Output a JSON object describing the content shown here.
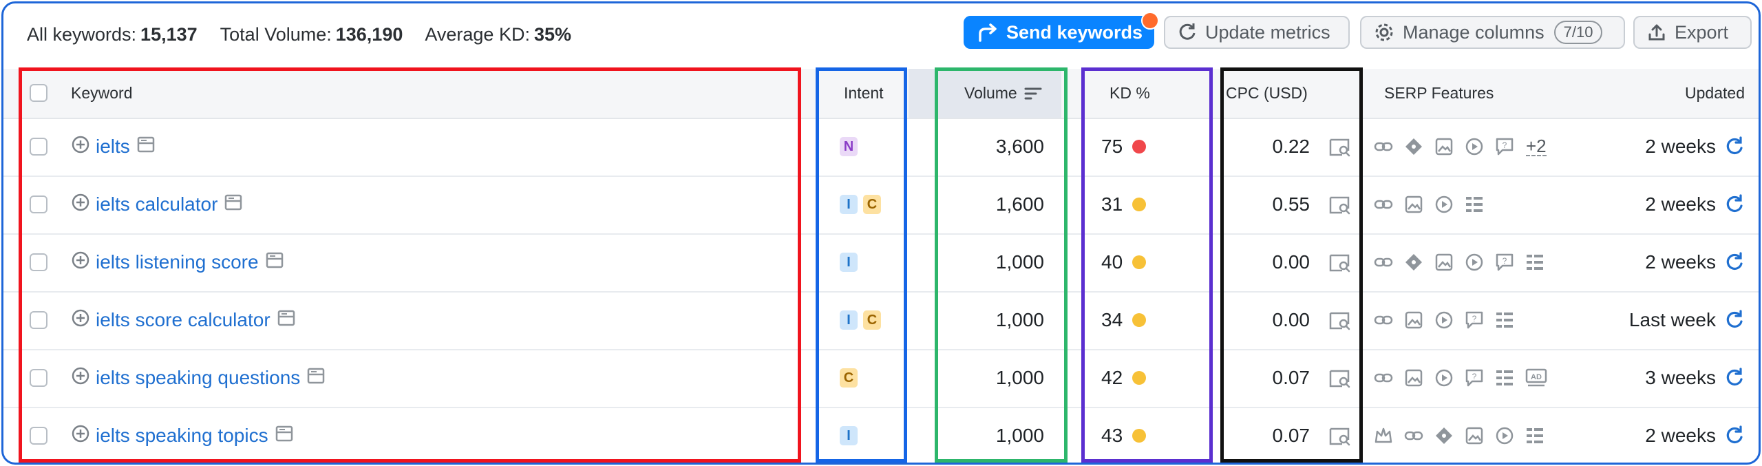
{
  "summary": {
    "all_keywords_label": "All keywords:",
    "all_keywords_value": "15,137",
    "total_volume_label": "Total Volume:",
    "total_volume_value": "136,190",
    "avg_kd_label": "Average KD:",
    "avg_kd_value": "35%"
  },
  "toolbar": {
    "send_label": "Send keywords",
    "update_label": "Update metrics",
    "manage_label": "Manage columns",
    "manage_count": "7/10",
    "export_label": "Export"
  },
  "columns": {
    "keyword": "Keyword",
    "intent": "Intent",
    "volume": "Volume",
    "kd": "KD %",
    "cpc": "CPC (USD)",
    "serp": "SERP Features",
    "updated": "Updated"
  },
  "rows": [
    {
      "keyword": "ielts",
      "intent": [
        "N"
      ],
      "volume": "3,600",
      "kd": "75",
      "kd_color": "#f0474b",
      "cpc": "0.22",
      "serp": [
        "link",
        "diamond",
        "image",
        "video",
        "qa"
      ],
      "more": "+2",
      "updated": "2 weeks"
    },
    {
      "keyword": "ielts calculator",
      "intent": [
        "I",
        "C"
      ],
      "volume": "1,600",
      "kd": "31",
      "kd_color": "#f7c137",
      "cpc": "0.55",
      "serp": [
        "link",
        "image",
        "video",
        "list"
      ],
      "more": "",
      "updated": "2 weeks"
    },
    {
      "keyword": "ielts listening score",
      "intent": [
        "I"
      ],
      "volume": "1,000",
      "kd": "40",
      "kd_color": "#f7c137",
      "cpc": "0.00",
      "serp": [
        "link",
        "diamond",
        "image",
        "video",
        "qa",
        "list"
      ],
      "more": "",
      "updated": "2 weeks"
    },
    {
      "keyword": "ielts score calculator",
      "intent": [
        "I",
        "C"
      ],
      "volume": "1,000",
      "kd": "34",
      "kd_color": "#f7c137",
      "cpc": "0.00",
      "serp": [
        "link",
        "image",
        "video",
        "qa",
        "list"
      ],
      "more": "",
      "updated": "Last week"
    },
    {
      "keyword": "ielts speaking questions",
      "intent": [
        "C"
      ],
      "volume": "1,000",
      "kd": "42",
      "kd_color": "#f7c137",
      "cpc": "0.07",
      "serp": [
        "link",
        "image",
        "video",
        "qa",
        "list",
        "ad"
      ],
      "more": "",
      "updated": "3 weeks"
    },
    {
      "keyword": "ielts speaking topics",
      "intent": [
        "I"
      ],
      "volume": "1,000",
      "kd": "43",
      "kd_color": "#f7c137",
      "cpc": "0.07",
      "serp": [
        "crown",
        "link",
        "diamond",
        "image",
        "video",
        "list"
      ],
      "more": "",
      "updated": "2 weeks"
    }
  ],
  "highlight_colors": {
    "keyword": "#f0141e",
    "intent": "#1565e6",
    "volume": "#2db66b",
    "kd": "#5b2fd0",
    "cpc": "#111111"
  }
}
